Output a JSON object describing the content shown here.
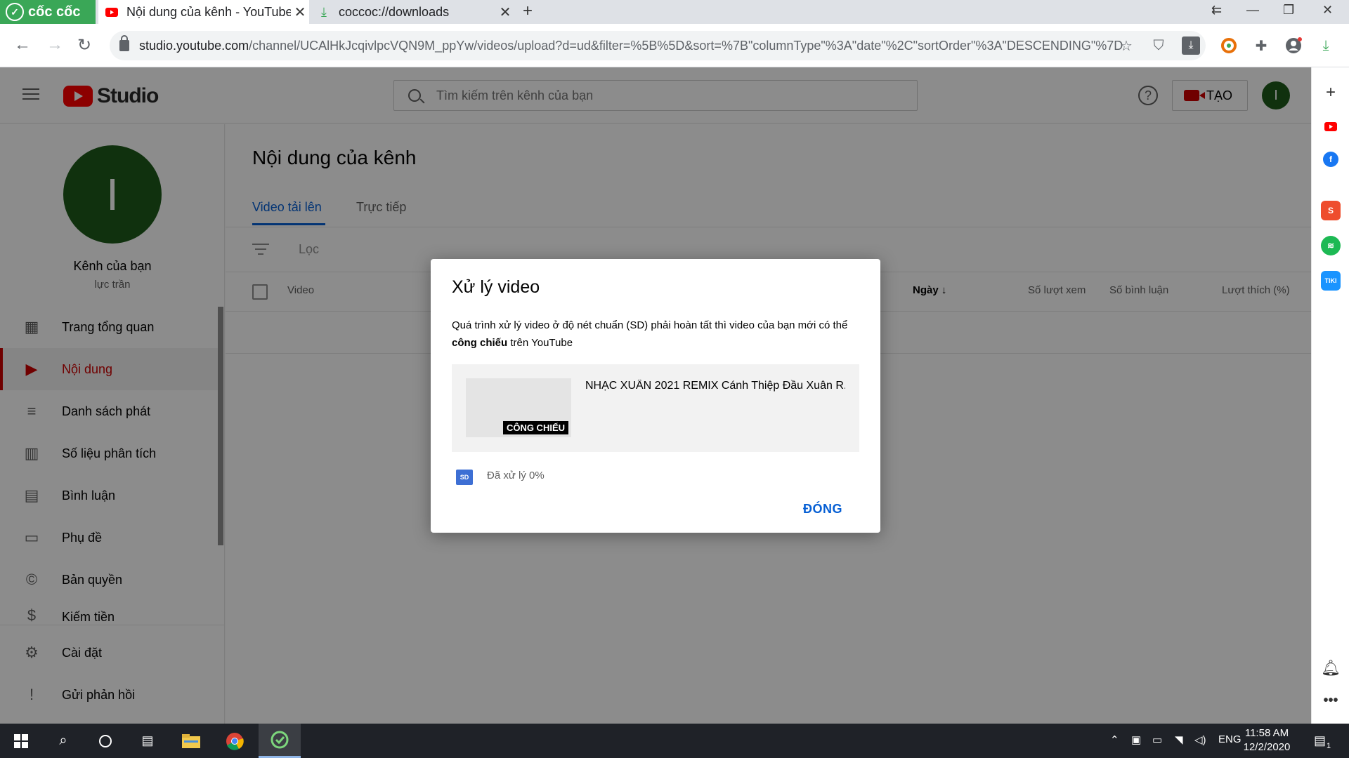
{
  "browser": {
    "brand": "cốc cốc",
    "tabs": [
      {
        "title": "Nội dung của kênh - YouTube Studio",
        "active": true
      },
      {
        "title": "coccoc://downloads",
        "active": false
      }
    ],
    "url": {
      "host": "studio.youtube.com",
      "path": "/channel/UCAlHkJcqivlpcVQN9M_ppYw/videos/upload?d=ud&filter=%5B%5D&sort=%7B\"columnType\"%3A\"date\"%2C\"sortOrder\"%3A\"DESCENDING\"%7D"
    }
  },
  "studio": {
    "logo_text": "Studio",
    "search_placeholder": "Tìm kiếm trên kênh của bạn",
    "create_label": "TẠO",
    "avatar_letter": "I"
  },
  "sidebar": {
    "avatar_letter": "I",
    "channel_label": "Kênh của bạn",
    "channel_handle": "lực trần",
    "items": [
      {
        "label": "Trang tổng quan",
        "icon": "dashboard-icon"
      },
      {
        "label": "Nội dung",
        "icon": "content-icon",
        "active": true
      },
      {
        "label": "Danh sách phát",
        "icon": "playlist-icon"
      },
      {
        "label": "Số liệu phân tích",
        "icon": "analytics-icon"
      },
      {
        "label": "Bình luận",
        "icon": "comments-icon"
      },
      {
        "label": "Phụ đề",
        "icon": "subtitles-icon"
      },
      {
        "label": "Bản quyền",
        "icon": "copyright-icon"
      },
      {
        "label": "Kiếm tiền",
        "icon": "monetization-icon"
      },
      {
        "label": "Cài đặt",
        "icon": "settings-icon"
      },
      {
        "label": "Gửi phản hồi",
        "icon": "feedback-icon"
      }
    ]
  },
  "main": {
    "page_title": "Nội dung của kênh",
    "tabs": [
      "Video tải lên",
      "Trực tiếp"
    ],
    "filter_placeholder": "Lọc",
    "columns": {
      "video": "Video",
      "date": "Ngày",
      "views": "Số lượt xem",
      "comments": "Số bình luận",
      "likes": "Lượt thích (%)"
    }
  },
  "dialog": {
    "title": "Xử lý video",
    "desc_before": "Quá trình xử lý video ở độ nét chuẩn (SD) phải hoàn tất thì video của bạn mới có thể ",
    "desc_bold": "công chiếu",
    "desc_after": " trên YouTube",
    "premiere_badge": "CÔNG CHIẾU",
    "video_title": "NHẠC XUÂN 2021 REMIX Cánh Thiệp Đầu Xuân R...",
    "sd_label": "SD",
    "processing_status": "Đã xử lý 0%",
    "close_label": "ĐÓNG"
  },
  "taskbar": {
    "language": "ENG",
    "time": "11:58 AM",
    "date": "12/2/2020",
    "notification_count": "1"
  },
  "colors": {
    "brand_red": "#ff0000",
    "link_blue": "#065fd4",
    "active_red": "#cc0000",
    "coccoc_green": "#3aa757"
  }
}
